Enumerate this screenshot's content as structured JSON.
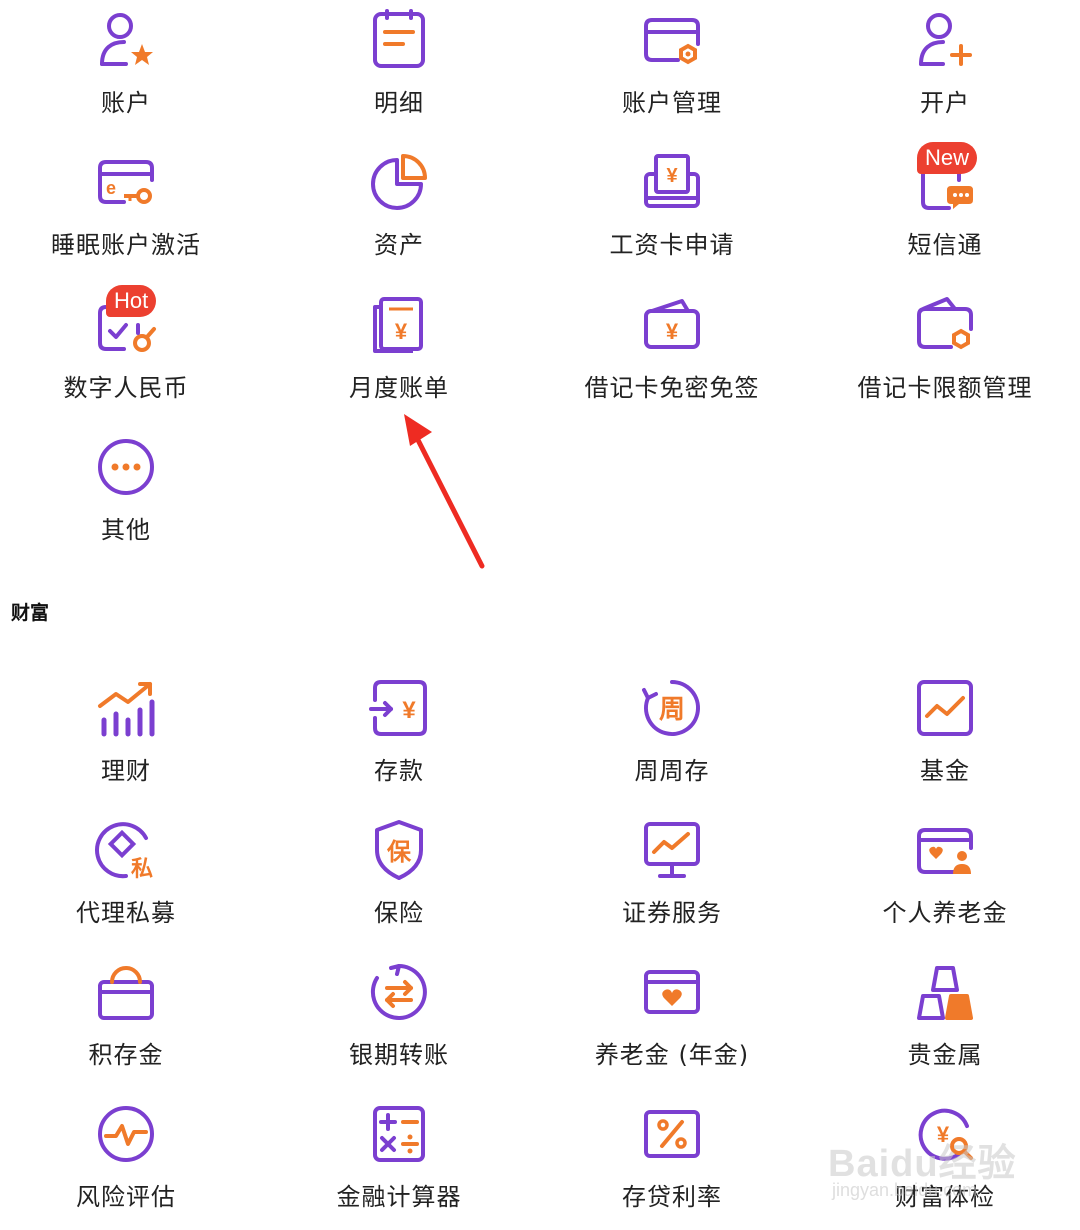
{
  "colors": {
    "purple": "#7b3fd0",
    "orange": "#f07a2a",
    "badge": "#ec4030"
  },
  "account_section": {
    "items": [
      {
        "label": "账户",
        "icon": "user-star-icon"
      },
      {
        "label": "明细",
        "icon": "details-icon"
      },
      {
        "label": "账户管理",
        "icon": "card-settings-icon"
      },
      {
        "label": "开户",
        "icon": "user-add-icon"
      },
      {
        "label": "睡眠账户激活",
        "icon": "card-key-icon"
      },
      {
        "label": "资产",
        "icon": "pie-chart-icon"
      },
      {
        "label": "工资卡申请",
        "icon": "salary-card-icon"
      },
      {
        "label": "短信通",
        "icon": "phone-message-icon",
        "badge": "New"
      },
      {
        "label": "数字人民币",
        "icon": "digital-rmb-icon",
        "badge": "Hot"
      },
      {
        "label": "月度账单",
        "icon": "monthly-bill-icon"
      },
      {
        "label": "借记卡免密免签",
        "icon": "debit-card-wallet-icon"
      },
      {
        "label": "借记卡限额管理",
        "icon": "wallet-limit-icon"
      },
      {
        "label": "其他",
        "icon": "more-icon"
      }
    ]
  },
  "wealth_section": {
    "title": "财富",
    "items": [
      {
        "label": "理财",
        "icon": "growth-chart-icon"
      },
      {
        "label": "存款",
        "icon": "deposit-icon"
      },
      {
        "label": "周周存",
        "icon": "weekly-deposit-icon",
        "glyph": "周"
      },
      {
        "label": "基金",
        "icon": "fund-icon"
      },
      {
        "label": "代理私募",
        "icon": "private-fund-icon",
        "glyph": "私"
      },
      {
        "label": "保险",
        "icon": "insurance-shield-icon",
        "glyph": "保"
      },
      {
        "label": "证券服务",
        "icon": "securities-monitor-icon"
      },
      {
        "label": "个人养老金",
        "icon": "pension-card-icon"
      },
      {
        "label": "积存金",
        "icon": "gold-bag-icon"
      },
      {
        "label": "银期转账",
        "icon": "transfer-icon"
      },
      {
        "label": "养老金 (年金)",
        "icon": "annuity-card-icon"
      },
      {
        "label": "贵金属",
        "icon": "gold-bars-icon"
      },
      {
        "label": "风险评估",
        "icon": "risk-pulse-icon"
      },
      {
        "label": "金融计算器",
        "icon": "calculator-icon"
      },
      {
        "label": "存贷利率",
        "icon": "interest-rate-icon"
      },
      {
        "label": "财富体检",
        "icon": "wealth-check-icon"
      }
    ]
  },
  "watermark": {
    "logo": "Baidu经验",
    "url": "jingyan.baidu.com"
  }
}
